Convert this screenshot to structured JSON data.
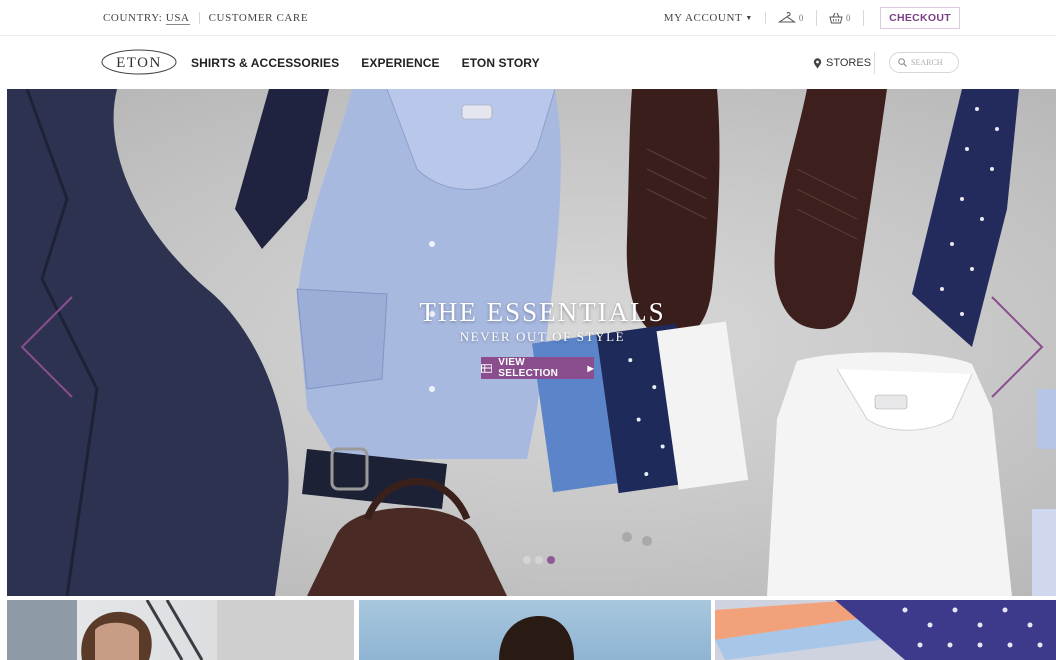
{
  "utility": {
    "country_label": "COUNTRY:",
    "country_value": "USA",
    "customer_care": "CUSTOMER CARE",
    "my_account": "MY ACCOUNT",
    "wishlist_count": "0",
    "cart_count": "0",
    "checkout": "CHECKOUT"
  },
  "nav": {
    "logo": "ETON",
    "items": [
      "SHIRTS & ACCESSORIES",
      "EXPERIENCE",
      "ETON STORY"
    ],
    "stores": "STORES",
    "search_placeholder": "SEARCH"
  },
  "hero": {
    "title": "THE ESSENTIALS",
    "subtitle": "NEVER OUT OF STYLE",
    "cta": "VIEW SELECTION",
    "slides_total": 3,
    "active_slide": 3
  },
  "colors": {
    "accent": "#8a4e8f",
    "checkout_text": "#7b3f86"
  },
  "icons": {
    "wishlist": "hanger-icon",
    "cart": "basket-icon",
    "stores": "map-pin-icon",
    "search": "search-icon",
    "cta": "gift-icon",
    "prev": "chevron-left-icon",
    "next": "chevron-right-icon"
  }
}
